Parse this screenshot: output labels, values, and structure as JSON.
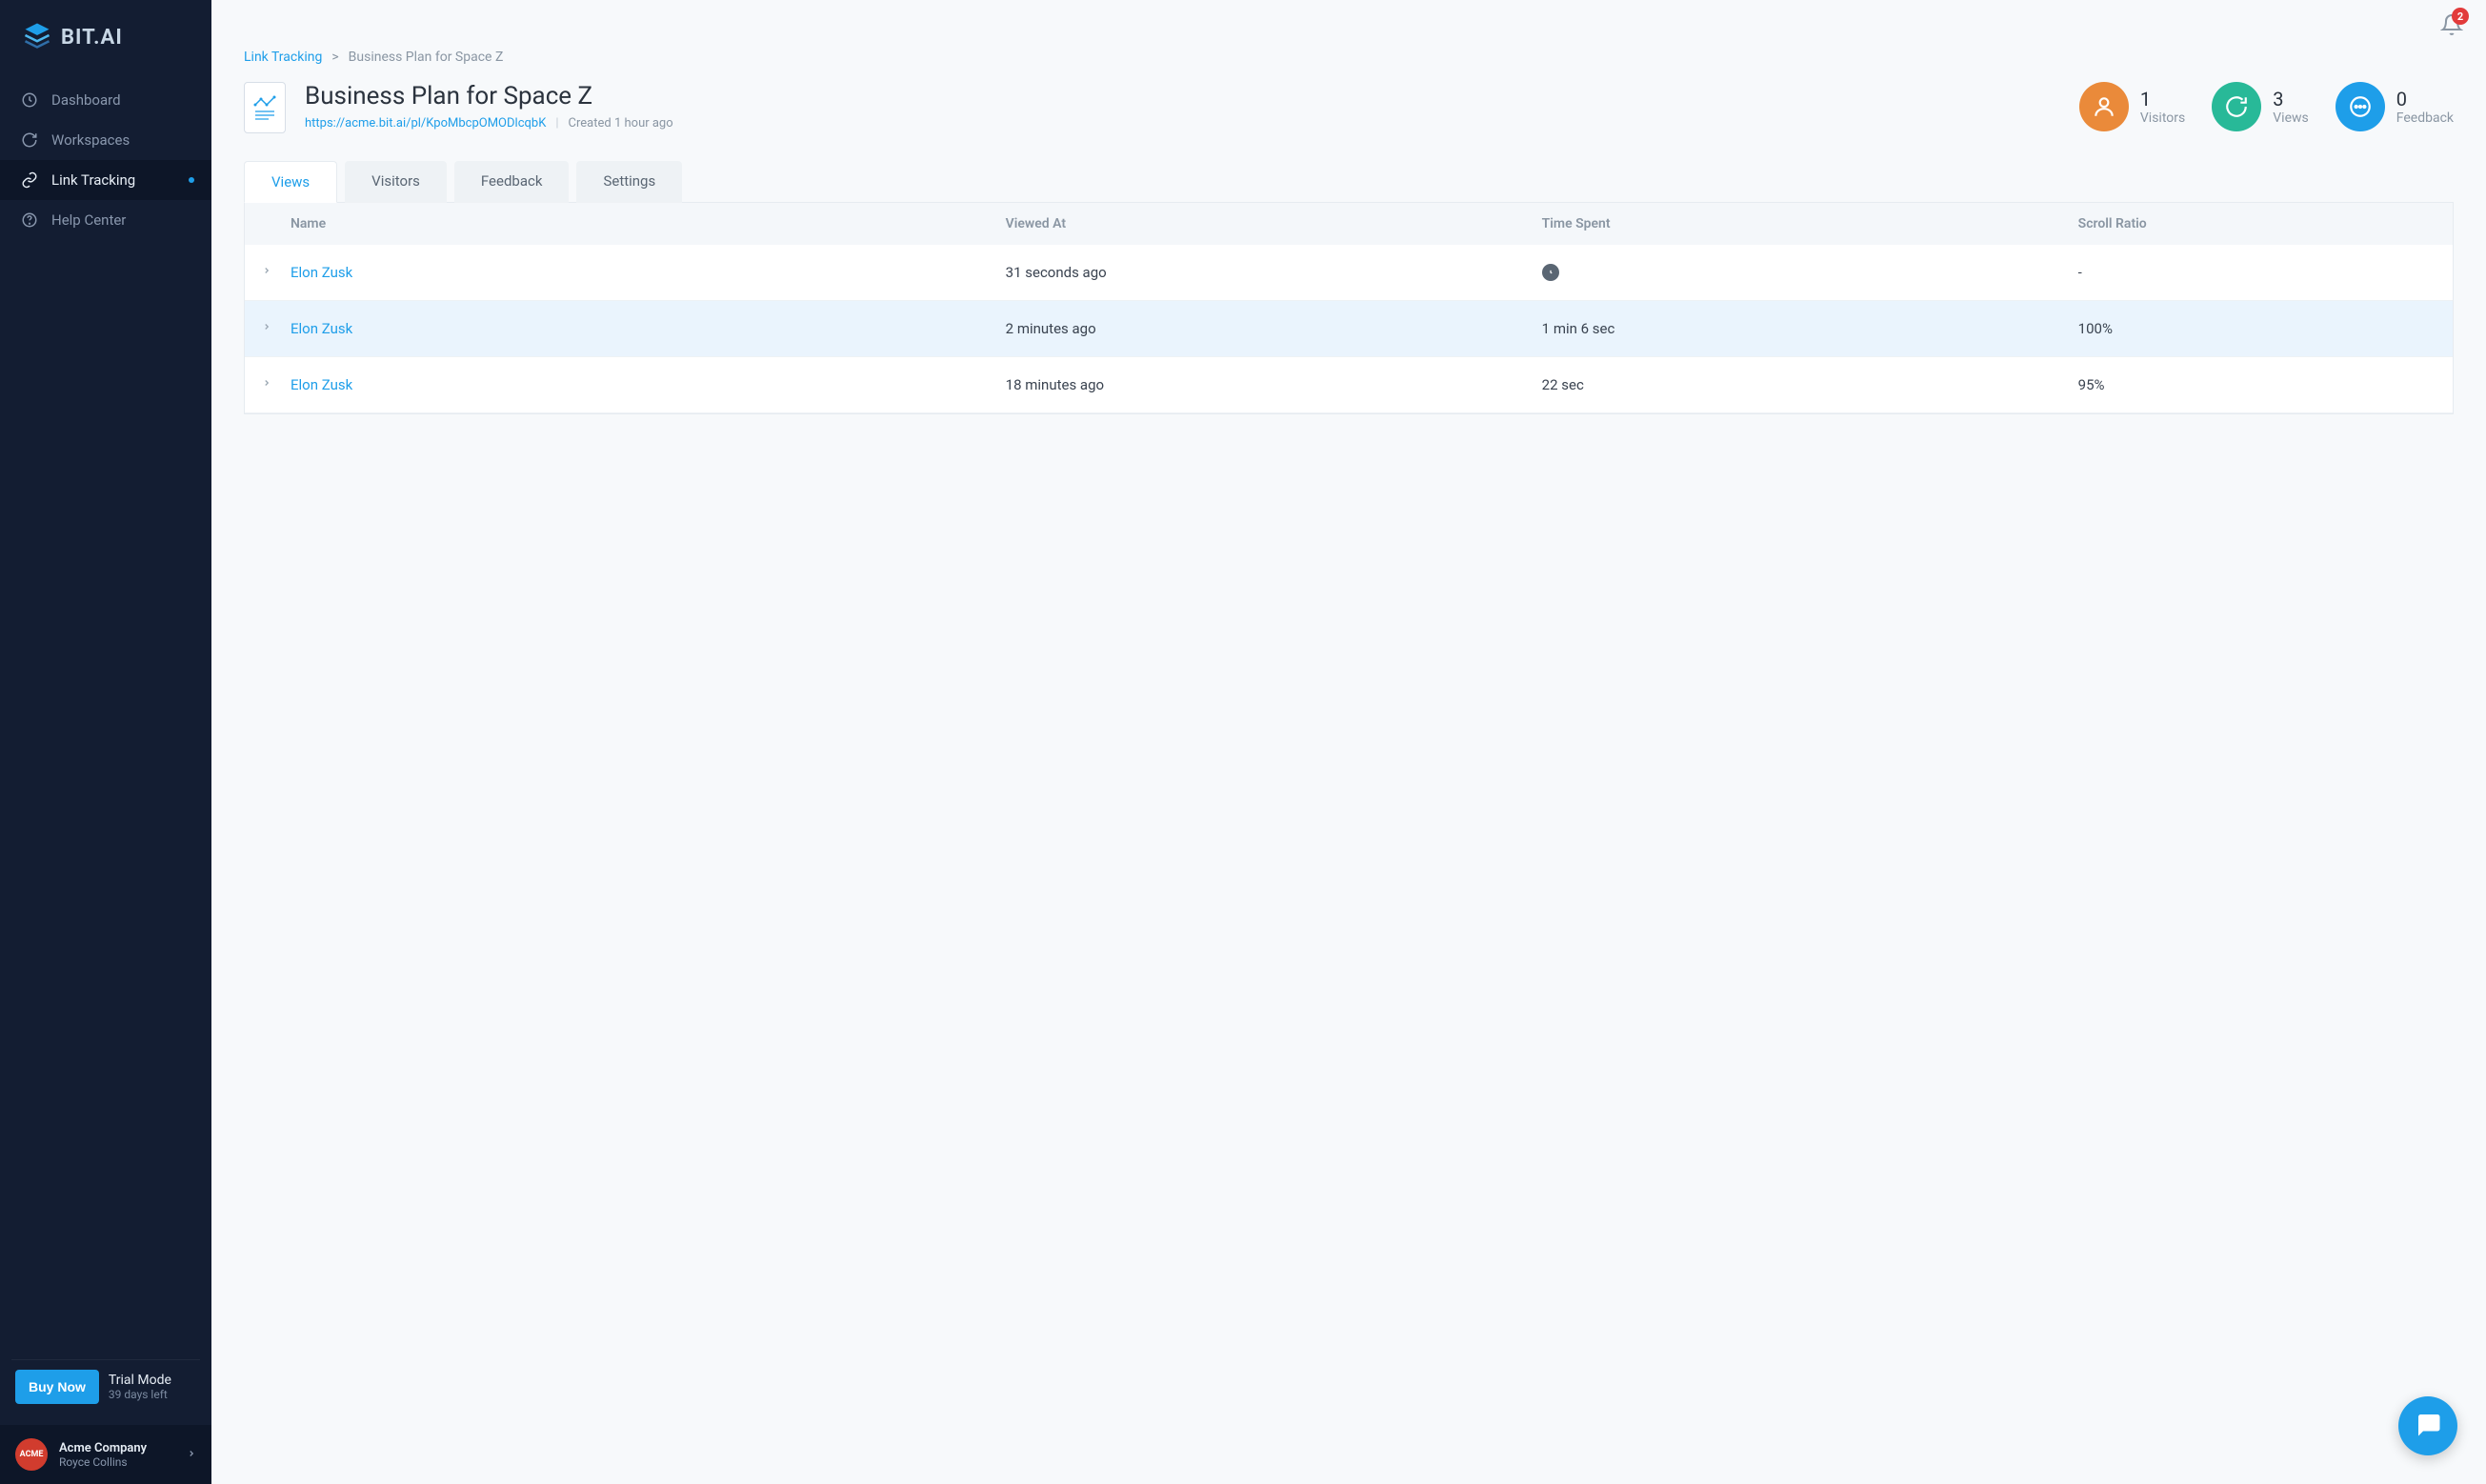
{
  "brand": "BIT.AI",
  "sidebar": {
    "items": [
      {
        "label": "Dashboard",
        "icon": "dashboard-icon"
      },
      {
        "label": "Workspaces",
        "icon": "refresh-icon"
      },
      {
        "label": "Link Tracking",
        "icon": "link-icon",
        "active": true
      },
      {
        "label": "Help Center",
        "icon": "help-icon"
      }
    ]
  },
  "trial": {
    "buy_label": "Buy Now",
    "mode_label": "Trial Mode",
    "days_left": "39 days left"
  },
  "user": {
    "avatar_text": "ACME",
    "company": "Acme Company",
    "name": "Royce Collins"
  },
  "notifications": {
    "count": "2"
  },
  "breadcrumb": {
    "root": "Link Tracking",
    "current": "Business Plan for Space Z",
    "separator": ">"
  },
  "doc": {
    "title": "Business Plan for Space Z",
    "url": "https://acme.bit.ai/pl/KpoMbcpOMODlcqbK",
    "created": "Created 1 hour ago"
  },
  "stats": [
    {
      "num": "1",
      "label": "Visitors",
      "color": "stat-orange"
    },
    {
      "num": "3",
      "label": "Views",
      "color": "stat-teal"
    },
    {
      "num": "0",
      "label": "Feedback",
      "color": "stat-blue"
    }
  ],
  "tabs": [
    {
      "label": "Views",
      "active": true
    },
    {
      "label": "Visitors"
    },
    {
      "label": "Feedback"
    },
    {
      "label": "Settings"
    }
  ],
  "table": {
    "headers": {
      "name": "Name",
      "viewed": "Viewed At",
      "time": "Time Spent",
      "scroll": "Scroll Ratio"
    },
    "rows": [
      {
        "name": "Elon Zusk",
        "viewed": "31 seconds ago",
        "time_icon": true,
        "time": "",
        "scroll": "-",
        "highlight": false
      },
      {
        "name": "Elon Zusk",
        "viewed": "2 minutes ago",
        "time": "1 min 6 sec",
        "scroll": "100%",
        "highlight": true
      },
      {
        "name": "Elon Zusk",
        "viewed": "18 minutes ago",
        "time": "22 sec",
        "scroll": "95%",
        "highlight": false
      }
    ]
  }
}
